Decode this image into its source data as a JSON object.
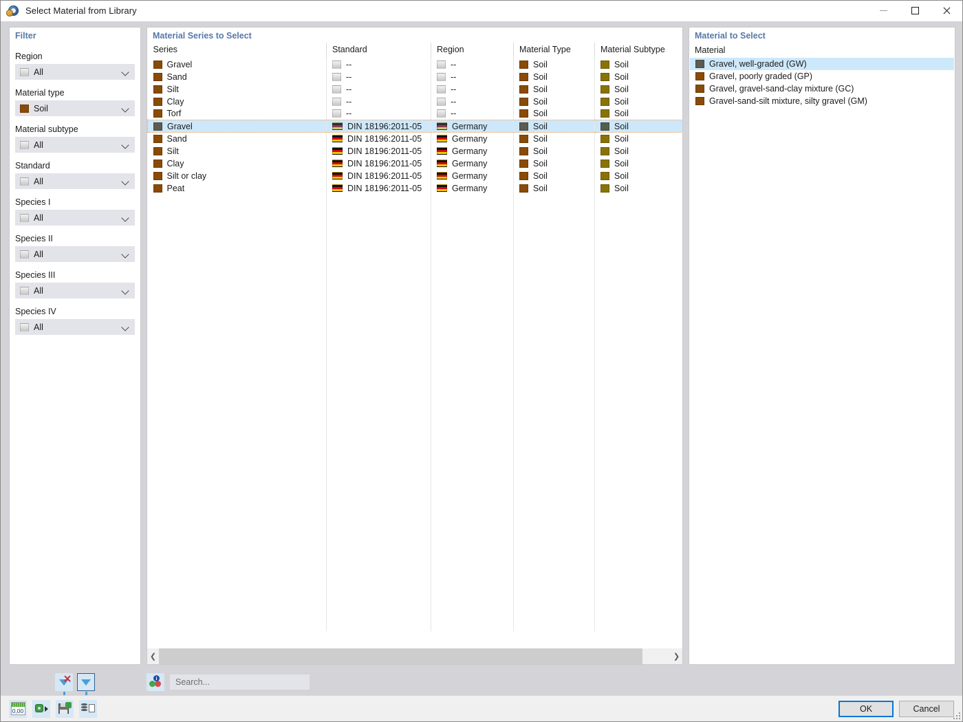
{
  "window": {
    "title": "Select Material from Library",
    "icon": "library-material-icon",
    "minimize_label": "Minimize",
    "maximize_label": "Maximize",
    "close_label": "Close"
  },
  "filter": {
    "panel_title": "Filter",
    "fields": [
      {
        "label": "Region",
        "value": "All",
        "swatch": "gray"
      },
      {
        "label": "Material type",
        "value": "Soil",
        "swatch": "soil"
      },
      {
        "label": "Material subtype",
        "value": "All",
        "swatch": "gray"
      },
      {
        "label": "Standard",
        "value": "All",
        "swatch": "gray"
      },
      {
        "label": "Species I",
        "value": "All",
        "swatch": "gray"
      },
      {
        "label": "Species II",
        "value": "All",
        "swatch": "gray"
      },
      {
        "label": "Species III",
        "value": "All",
        "swatch": "gray"
      },
      {
        "label": "Species IV",
        "value": "All",
        "swatch": "gray"
      }
    ]
  },
  "series": {
    "panel_title": "Material Series to Select",
    "columns": [
      "Series",
      "Standard",
      "Region",
      "Material Type",
      "Material Subtype"
    ],
    "rows": [
      {
        "series": "Gravel",
        "standard": "--",
        "region": "--",
        "material_type": "Soil",
        "material_subtype": "Soil",
        "selected": false,
        "flag": "none"
      },
      {
        "series": "Sand",
        "standard": "--",
        "region": "--",
        "material_type": "Soil",
        "material_subtype": "Soil",
        "selected": false,
        "flag": "none"
      },
      {
        "series": "Silt",
        "standard": "--",
        "region": "--",
        "material_type": "Soil",
        "material_subtype": "Soil",
        "selected": false,
        "flag": "none"
      },
      {
        "series": "Clay",
        "standard": "--",
        "region": "--",
        "material_type": "Soil",
        "material_subtype": "Soil",
        "selected": false,
        "flag": "none"
      },
      {
        "series": "Torf",
        "standard": "--",
        "region": "--",
        "material_type": "Soil",
        "material_subtype": "Soil",
        "selected": false,
        "flag": "none"
      },
      {
        "series": "Gravel",
        "standard": "DIN 18196:2011-05",
        "region": "Germany",
        "material_type": "Soil",
        "material_subtype": "Soil",
        "selected": true,
        "flag": "de"
      },
      {
        "series": "Sand",
        "standard": "DIN 18196:2011-05",
        "region": "Germany",
        "material_type": "Soil",
        "material_subtype": "Soil",
        "selected": false,
        "flag": "de"
      },
      {
        "series": "Silt",
        "standard": "DIN 18196:2011-05",
        "region": "Germany",
        "material_type": "Soil",
        "material_subtype": "Soil",
        "selected": false,
        "flag": "de"
      },
      {
        "series": "Clay",
        "standard": "DIN 18196:2011-05",
        "region": "Germany",
        "material_type": "Soil",
        "material_subtype": "Soil",
        "selected": false,
        "flag": "de"
      },
      {
        "series": "Silt or clay",
        "standard": "DIN 18196:2011-05",
        "region": "Germany",
        "material_type": "Soil",
        "material_subtype": "Soil",
        "selected": false,
        "flag": "de"
      },
      {
        "series": "Peat",
        "standard": "DIN 18196:2011-05",
        "region": "Germany",
        "material_type": "Soil",
        "material_subtype": "Soil",
        "selected": false,
        "flag": "de"
      }
    ]
  },
  "materials": {
    "panel_title": "Material to Select",
    "column": "Material",
    "rows": [
      {
        "label": "Gravel, well-graded (GW)",
        "selected": true
      },
      {
        "label": "Gravel, poorly graded (GP)",
        "selected": false
      },
      {
        "label": "Gravel, gravel-sand-clay mixture (GC)",
        "selected": false
      },
      {
        "label": "Gravel-sand-silt mixture, silty gravel (GM)",
        "selected": false
      }
    ]
  },
  "toolbar": {
    "clear_filter_label": "Clear filter",
    "filter_label": "Filter",
    "search_icon_label": "Search options",
    "search_placeholder": "Search...",
    "search_value": ""
  },
  "footer": {
    "buttons": [
      {
        "name": "units-button",
        "tooltip": "Units / number format"
      },
      {
        "name": "export-button",
        "tooltip": "Export"
      },
      {
        "name": "save-button",
        "tooltip": "Save to library"
      },
      {
        "name": "copy-report-button",
        "tooltip": "Copy to report"
      }
    ],
    "ok_label": "OK",
    "cancel_label": "Cancel"
  },
  "scrollbar": {
    "left_arrow": "❮",
    "right_arrow": "❯"
  },
  "colors": {
    "accent": "#0078d7",
    "panel_title": "#5878a8",
    "selection": "#cde8fb",
    "selection_outline": "#e08a3c",
    "soil_swatch": "#8a4b06",
    "subtype_swatch": "#8a7206"
  }
}
